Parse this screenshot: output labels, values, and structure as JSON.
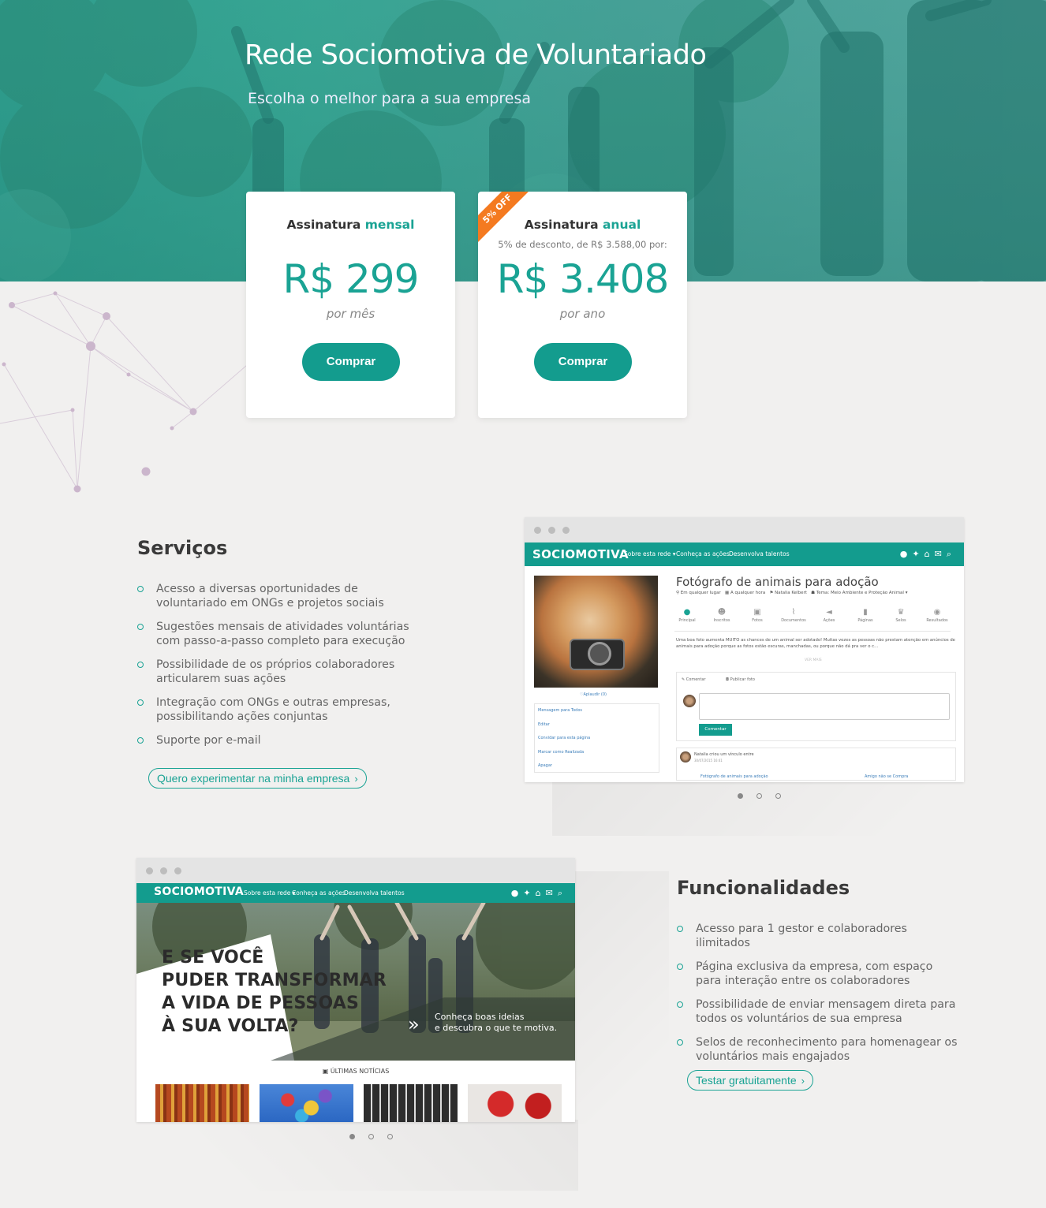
{
  "hero": {
    "title": "Rede Sociomotiva de Voluntariado",
    "subtitle": "Escolha o melhor para a sua empresa"
  },
  "plans": [
    {
      "title_prefix": "Assinatura",
      "title_accent": "mensal",
      "note": "",
      "price": "R$ 299",
      "period": "por mês",
      "button": "Comprar"
    },
    {
      "title_prefix": "Assinatura",
      "title_accent": "anual",
      "note": "5% de desconto, de R$ 3.588,00 por:",
      "price": "R$ 3.408",
      "period": "por ano",
      "button": "Comprar",
      "ribbon": "5% OFF"
    }
  ],
  "services": {
    "title": "Serviços",
    "items": [
      "Acesso a diversas oportunidades de voluntariado em ONGs e projetos sociais",
      "Sugestões mensais de atividades voluntárias com passo-a-passo completo para execução",
      "Possibilidade de os próprios colaboradores articularem suas ações",
      "Integração com ONGs e outras empresas, possibilitando ações conjuntas",
      "Suporte por e-mail"
    ],
    "cta": "Quero experimentar na minha empresa",
    "cta_icon": "chevron-right-icon"
  },
  "features": {
    "title": "Funcionalidades",
    "items": [
      "Acesso para 1 gestor e colaboradores ilimitados",
      "Página exclusiva da empresa, com espaço para interação entre os colaboradores",
      "Possibilidade de enviar mensagem direta para todos os voluntários de sua empresa",
      "Selos de reconhecimento para homenagear os voluntários mais engajados"
    ],
    "cta": "Testar gratuitamente",
    "cta_icon": "chevron-right-icon"
  },
  "app": {
    "logo": "SOCIOMOTIVA",
    "menu": [
      "Sobre esta rede ▾",
      "Conheça as ações",
      "Desenvolva talentos"
    ],
    "icons": [
      "avatar-icon",
      "notification-icon",
      "home-icon",
      "mail-icon",
      "search-icon"
    ]
  },
  "screenshot1": {
    "heading": "Fotógrafo de animais para adoção",
    "meta": [
      "Em qualquer lugar",
      "A qualquer hora",
      "Natalia Kelbert",
      "Tema: Meio Ambiente e Proteção Animal ▾"
    ],
    "tabs": [
      "Principal",
      "Inscritos",
      "Fotos",
      "Documentos",
      "Ações",
      "Páginas",
      "Selos",
      "Resultados"
    ],
    "description": "Uma boa foto aumenta MUITO as chances de um animal ser adotado! Muitas vezes as pessoas não prestam atenção em anúncios de animais para adoção porque as fotos estão escuras, manchadas, ou porque não dá pra ver o c...",
    "more": "VER MAIS",
    "applaud": "Aplaudir (0)",
    "side_menu": [
      "Mensagem para Todos",
      "Editar",
      "Convidar para esta página",
      "Marcar como Realizada",
      "Apagar"
    ],
    "comment_tabs": [
      "Comentar",
      "Publicar foto"
    ],
    "comment_button": "Comentar",
    "activity_text": "Natalia criou um vínculo entre",
    "activity_date": "30/07/2015 16:41",
    "activity_links": [
      "Fotógrafo de animais para adoção",
      "Amigo não se Compra"
    ]
  },
  "screenshot2": {
    "headline": [
      "E SE VOCÊ",
      "PUDER TRANSFORMAR",
      "A VIDA DE PESSOAS",
      "À SUA VOLTA?"
    ],
    "cta": [
      "Conheça boas ideias",
      "e descubra o que te motiva."
    ],
    "news_title": "ÚLTIMAS NOTÍCIAS"
  },
  "carousels": {
    "screenshot1_active": 1,
    "screenshot2_active": 1,
    "count": 3
  },
  "colors": {
    "accent": "#1aa394",
    "button": "#139c8e",
    "ribbon": "#f47a20",
    "background": "#f1f0ef"
  }
}
